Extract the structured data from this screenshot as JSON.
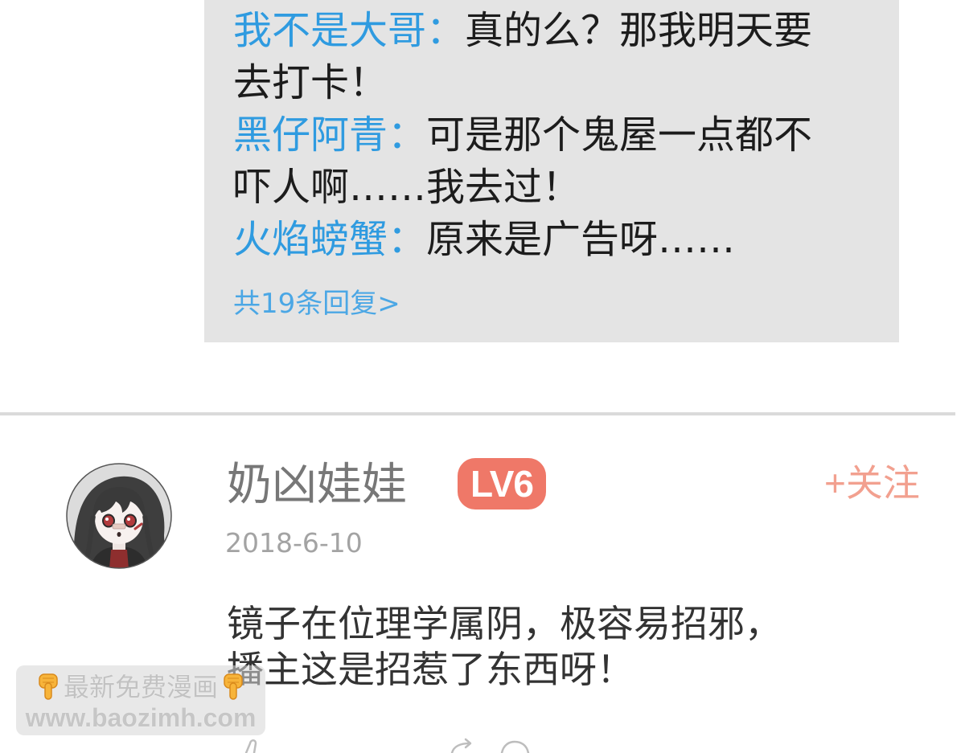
{
  "reply_preview": {
    "replies": [
      {
        "author": "我不是大哥：",
        "text": "真的么？那我明天要去打卡！"
      },
      {
        "author": "黑仔阿青：",
        "text": "可是那个鬼屋一点都不吓人啊……我去过！"
      },
      {
        "author": "火焰螃蟹：",
        "text": "原来是广告呀……"
      }
    ],
    "more_replies_label": "共19条回复>"
  },
  "comment": {
    "avatar_icon": "avatar",
    "username": "奶凶娃娃",
    "level_badge": "LV6",
    "follow_label": "+关注",
    "date": "2018-6-10",
    "text": "镜子在位理学属阴，极容易招邪，播主这是招惹了东西呀！"
  },
  "action_bar": {
    "icons": [
      "thumbs-up-icon",
      "share-icon",
      "comment-icon"
    ]
  },
  "watermark": {
    "icon": "pointing-down-icon",
    "title": "最新免费漫画",
    "url": "www.baozimh.com"
  },
  "colors": {
    "reply_author": "#2f9be0",
    "more_replies": "#4ba7e5",
    "reply_box_bg": "#e4e4e4",
    "level_badge_bg": "#ef7868",
    "follow": "#f2a08f",
    "divider": "#dadada"
  }
}
